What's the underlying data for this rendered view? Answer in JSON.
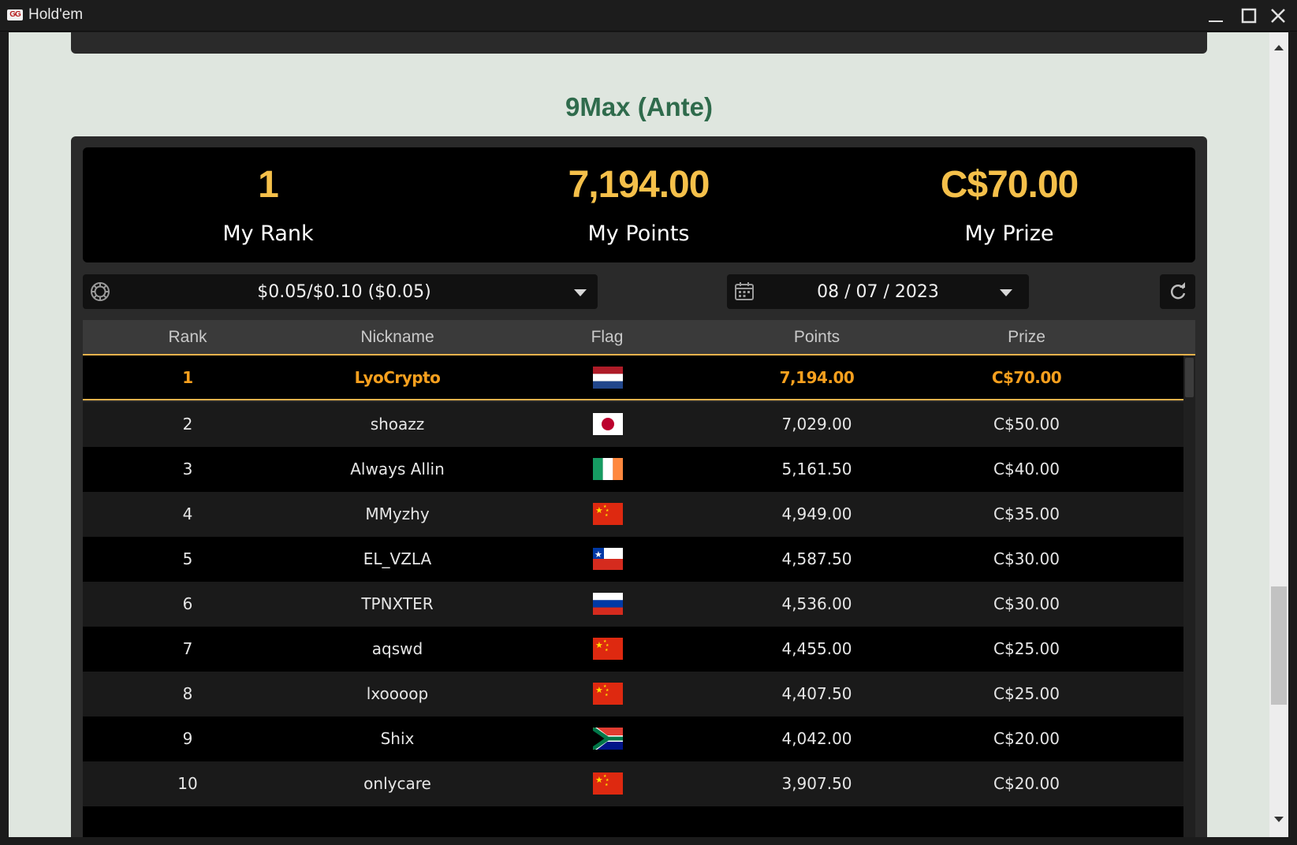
{
  "window": {
    "title": "Hold'em",
    "logo_text": "GG"
  },
  "section": {
    "title": "9Max (Ante)"
  },
  "stats": {
    "rank_value": "1",
    "rank_label": "My Rank",
    "points_value": "7,194.00",
    "points_label": "My Points",
    "prize_value": "C$70.00",
    "prize_label": "My Prize"
  },
  "filters": {
    "stakes": "$0.05/$0.10 ($0.05)",
    "date": "08 / 07 / 2023"
  },
  "table": {
    "headers": {
      "rank": "Rank",
      "nickname": "Nickname",
      "flag": "Flag",
      "points": "Points",
      "prize": "Prize"
    },
    "rows": [
      {
        "rank": "1",
        "nickname": "LyoCrypto",
        "flag": "netherlands",
        "points": "7,194.00",
        "prize": "C$70.00",
        "highlight": true
      },
      {
        "rank": "2",
        "nickname": "shoazz",
        "flag": "japan",
        "points": "7,029.00",
        "prize": "C$50.00"
      },
      {
        "rank": "3",
        "nickname": "Always Allin",
        "flag": "ireland",
        "points": "5,161.50",
        "prize": "C$40.00"
      },
      {
        "rank": "4",
        "nickname": "MMyzhy",
        "flag": "china",
        "points": "4,949.00",
        "prize": "C$35.00"
      },
      {
        "rank": "5",
        "nickname": "EL_VZLA",
        "flag": "chile",
        "points": "4,587.50",
        "prize": "C$30.00"
      },
      {
        "rank": "6",
        "nickname": "TPNXTER",
        "flag": "russia",
        "points": "4,536.00",
        "prize": "C$30.00"
      },
      {
        "rank": "7",
        "nickname": "aqswd",
        "flag": "china",
        "points": "4,455.00",
        "prize": "C$25.00"
      },
      {
        "rank": "8",
        "nickname": "lxoooop",
        "flag": "china",
        "points": "4,407.50",
        "prize": "C$25.00"
      },
      {
        "rank": "9",
        "nickname": "Shix",
        "flag": "south-africa",
        "points": "4,042.00",
        "prize": "C$20.00"
      },
      {
        "rank": "10",
        "nickname": "onlycare",
        "flag": "china",
        "points": "3,907.50",
        "prize": "C$20.00"
      }
    ]
  },
  "colors": {
    "accent": "#f5c04a",
    "highlight_row_text": "#f7a01e",
    "section_title": "#2f6b4c"
  }
}
